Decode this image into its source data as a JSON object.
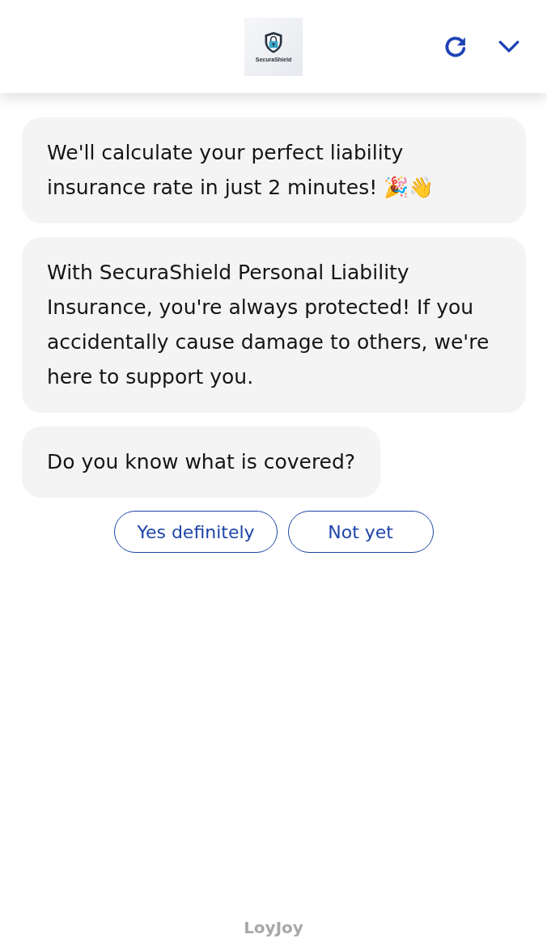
{
  "header": {
    "logo_text": "SecuraShield"
  },
  "messages": [
    {
      "text": "We'll calculate your perfect liability insurance rate in just 2 minutes!",
      "emoji": [
        "🎉",
        "👋"
      ]
    },
    {
      "text": "With SecuraShield Personal Liability Insurance, you're always protected! If you accidentally cause damage to others, we're here to support you."
    },
    {
      "text": "Do you know what is covered?"
    }
  ],
  "quick_replies": [
    "Yes definitely",
    "Not yet"
  ],
  "footer": {
    "brand": "LoyJoy"
  }
}
